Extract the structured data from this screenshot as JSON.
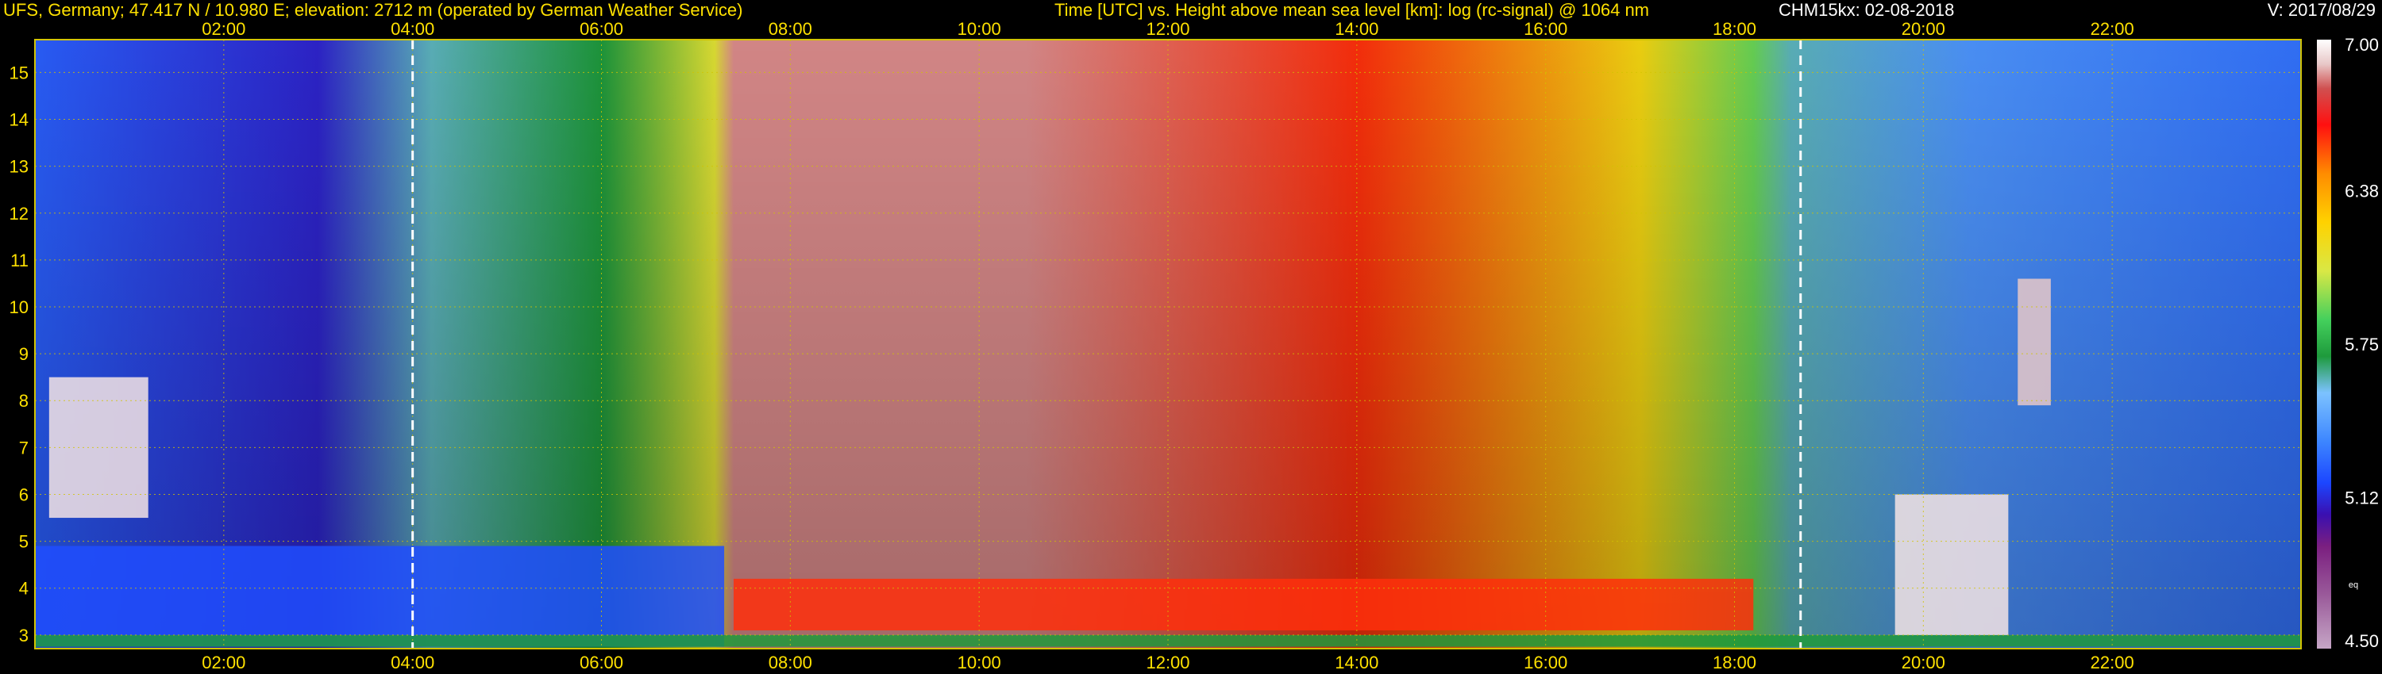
{
  "header": {
    "station": "UFS, Germany; 47.417 N / 10.980 E; elevation: 2712 m  (operated by German Weather Service)",
    "axes": "Time [UTC] vs. Height above mean sea level [km]: log (rc-signal) @ 1064 nm",
    "instrument": "CHM15kx: 02-08-2018",
    "version": "V: 2017/08/29"
  },
  "colors": {
    "header_text": "#ffe100",
    "tick_text": "#ffe100",
    "background": "#000000",
    "grid": "#d2c400",
    "night_marker": "#ffffff"
  },
  "chart_data": {
    "type": "heatmap",
    "title": "Time [UTC] vs. Height above mean sea level [km]: log (rc-signal) @ 1064 nm",
    "x_axis": {
      "unit": "UTC",
      "range_hours": [
        0,
        24
      ],
      "ticks": [
        {
          "hour": 2,
          "label": "02:00"
        },
        {
          "hour": 4,
          "label": "04:00"
        },
        {
          "hour": 6,
          "label": "06:00"
        },
        {
          "hour": 8,
          "label": "08:00"
        },
        {
          "hour": 10,
          "label": "10:00"
        },
        {
          "hour": 12,
          "label": "12:00"
        },
        {
          "hour": 14,
          "label": "14:00"
        },
        {
          "hour": 16,
          "label": "16:00"
        },
        {
          "hour": 18,
          "label": "18:00"
        },
        {
          "hour": 20,
          "label": "20:00"
        },
        {
          "hour": 22,
          "label": "22:00"
        }
      ]
    },
    "y_axis": {
      "unit": "km",
      "range_km": [
        2.71,
        15.7
      ],
      "ticks": [
        {
          "km": 3,
          "label": "3"
        },
        {
          "km": 4,
          "label": "4"
        },
        {
          "km": 5,
          "label": "5"
        },
        {
          "km": 6,
          "label": "6"
        },
        {
          "km": 7,
          "label": "7"
        },
        {
          "km": 8,
          "label": "8"
        },
        {
          "km": 9,
          "label": "9"
        },
        {
          "km": 10,
          "label": "10"
        },
        {
          "km": 11,
          "label": "11"
        },
        {
          "km": 12,
          "label": "12"
        },
        {
          "km": 13,
          "label": "13"
        },
        {
          "km": 14,
          "label": "14"
        },
        {
          "km": 15,
          "label": "15"
        }
      ]
    },
    "grid": true,
    "night_markers_hours": [
      4.0,
      18.7
    ],
    "colorbar": {
      "range": [
        4.5,
        7.0
      ],
      "labels": [
        {
          "value": 7.0,
          "label": "7.00"
        },
        {
          "value": 6.38,
          "label": "6.38"
        },
        {
          "value": 5.75,
          "label": "5.75"
        },
        {
          "value": 5.12,
          "label": "5.12"
        },
        {
          "value": 4.5,
          "label": "4.50"
        }
      ],
      "small_label": "eq",
      "small_label_value": 4.75,
      "stops": [
        {
          "value": 4.5,
          "color": "#c6a6c6"
        },
        {
          "value": 4.72,
          "color": "#9a5a9a"
        },
        {
          "value": 4.92,
          "color": "#7b1f80"
        },
        {
          "value": 5.05,
          "color": "#3a0fb0"
        },
        {
          "value": 5.18,
          "color": "#1c46ff"
        },
        {
          "value": 5.35,
          "color": "#3d86ff"
        },
        {
          "value": 5.55,
          "color": "#7cc2ff"
        },
        {
          "value": 5.7,
          "color": "#1e9a3c"
        },
        {
          "value": 5.85,
          "color": "#44d05c"
        },
        {
          "value": 6.05,
          "color": "#d9e845"
        },
        {
          "value": 6.25,
          "color": "#ffd200"
        },
        {
          "value": 6.45,
          "color": "#ff8c00"
        },
        {
          "value": 6.65,
          "color": "#ff1010"
        },
        {
          "value": 6.8,
          "color": "#d05050"
        },
        {
          "value": 6.9,
          "color": "#e8c8c8"
        },
        {
          "value": 7.0,
          "color": "#ffffff"
        }
      ]
    },
    "background_profile": [
      {
        "hour": 0.0,
        "value": 5.25
      },
      {
        "hour": 3.0,
        "value": 5.1
      },
      {
        "hour": 4.2,
        "value": 5.6
      },
      {
        "hour": 6.0,
        "value": 5.7
      },
      {
        "hour": 7.2,
        "value": 6.1
      },
      {
        "hour": 7.4,
        "value": 6.85
      },
      {
        "hour": 10.5,
        "value": 6.85
      },
      {
        "hour": 14.0,
        "value": 6.6
      },
      {
        "hour": 17.0,
        "value": 6.2
      },
      {
        "hour": 18.2,
        "value": 5.9
      },
      {
        "hour": 18.6,
        "value": 5.6
      },
      {
        "hour": 20.5,
        "value": 5.4
      },
      {
        "hour": 24.0,
        "value": 5.3
      }
    ],
    "features": [
      {
        "kind": "boundary_layer_aerosol",
        "hour_start": 0.0,
        "hour_end": 7.3,
        "km_bottom": 2.75,
        "km_top": 4.9,
        "value": 5.2
      },
      {
        "kind": "surface_layer",
        "hour_start": 0.0,
        "hour_end": 24.0,
        "km_bottom": 2.75,
        "km_top": 3.0,
        "value": 5.7
      },
      {
        "kind": "cloud",
        "hour_start": 0.15,
        "hour_end": 1.2,
        "km_bottom": 5.5,
        "km_top": 8.5,
        "value": 6.95
      },
      {
        "kind": "cloud",
        "hour_start": 19.7,
        "hour_end": 20.9,
        "km_bottom": 3.0,
        "km_top": 6.0,
        "value": 6.95
      },
      {
        "kind": "cirrus",
        "hour_start": 21.0,
        "hour_end": 21.35,
        "km_bottom": 7.9,
        "km_top": 10.6,
        "value": 6.9
      },
      {
        "kind": "convective_layer",
        "hour_start": 7.4,
        "hour_end": 18.2,
        "km_bottom": 3.1,
        "km_top": 4.2,
        "value": 6.6
      }
    ]
  }
}
